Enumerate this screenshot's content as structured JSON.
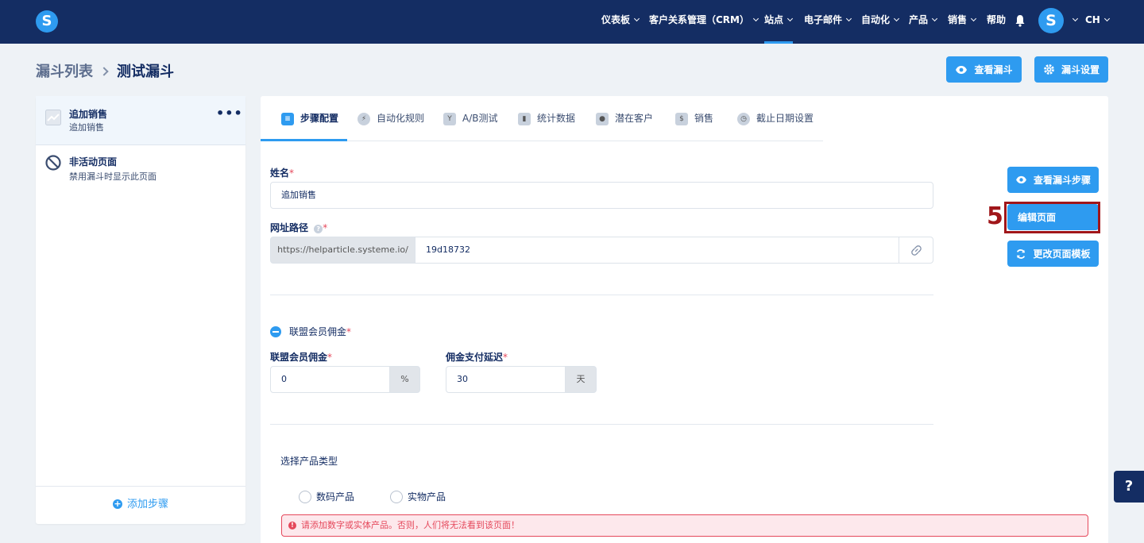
{
  "logo": "S",
  "nav": {
    "items": [
      {
        "label": "仪表板"
      },
      {
        "label": "客户关系管理（CRM）"
      },
      {
        "label": "站点"
      },
      {
        "label": "电子邮件"
      },
      {
        "label": "自动化"
      },
      {
        "label": "产品"
      },
      {
        "label": "销售"
      },
      {
        "label": "帮助"
      }
    ],
    "avatar_letter": "S",
    "language": "CH"
  },
  "breadcrumb": {
    "parent": "漏斗列表",
    "current": "测试漏斗"
  },
  "header_buttons": {
    "view_funnel": "查看漏斗",
    "funnel_settings": "漏斗设置"
  },
  "sidebar": {
    "steps": [
      {
        "title": "追加销售",
        "subtitle": "追加销售"
      },
      {
        "title": "非活动页面",
        "subtitle": "禁用漏斗时显示此页面"
      }
    ],
    "add_step": "添加步骤"
  },
  "tabs": [
    {
      "label": "步骤配置"
    },
    {
      "label": "自动化规则"
    },
    {
      "label": "A/B测试"
    },
    {
      "label": "统计数据"
    },
    {
      "label": "潜在客户"
    },
    {
      "label": "销售"
    },
    {
      "label": "截止日期设置"
    }
  ],
  "form": {
    "name_label": "姓名",
    "name_value": "追加销售",
    "url_label": "网址路径",
    "url_prefix": "https://helparticle.systeme.io/",
    "url_value": "19d18732",
    "affiliate_toggle_label": "联盟会员佣金",
    "commission_label": "联盟会员佣金",
    "commission_value": "0",
    "commission_unit": "%",
    "delay_label": "佣金支付延迟",
    "delay_value": "30",
    "delay_unit": "天",
    "product_type_label": "选择产品类型",
    "product_types": [
      "数码产品",
      "实物产品"
    ],
    "alert": "请添加数字或实体产品。否则，人们将无法看到该页面！"
  },
  "side_buttons": {
    "view_step": "查看漏斗步骤",
    "edit_page": "编辑页面",
    "change_template": "更改页面模板"
  },
  "annotation": "5",
  "help": "?",
  "colors": {
    "navy": "#142d63",
    "accent": "#2e9bf0",
    "error": "#e5485b",
    "annotation": "#a0161a"
  }
}
